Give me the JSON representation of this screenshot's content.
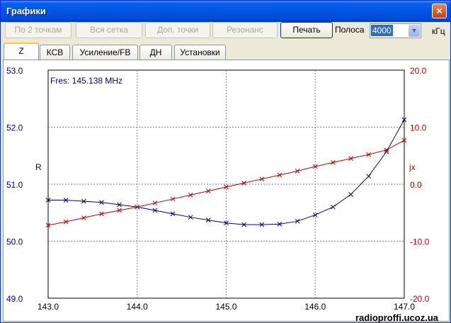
{
  "window": {
    "title": "Графики",
    "close_label": "×"
  },
  "toolbar": {
    "buttons": [
      "По 2 точкам",
      "Вся сетка",
      "Доп. точки",
      "Резонанс"
    ],
    "print_label": "Печать",
    "band_label": "Полоса",
    "band_value": "4000",
    "unit_label": "кГц"
  },
  "tabs": [
    "Z",
    "КСВ",
    "Усиление/FB",
    "ДН",
    "Установки"
  ],
  "active_tab": "Z",
  "chart": {
    "fres_text": "Fres: 145.138 MHz",
    "left_axis_label": "R",
    "right_axis_label": "jx",
    "watermark": "radioproffi.ucoz.ua"
  },
  "colors": {
    "r_series": "#00008b",
    "x_series": "#c00000",
    "grid": "#808080"
  },
  "chart_data": {
    "type": "line",
    "x_ticks": [
      "143.0",
      "144.0",
      "145.0",
      "146.0",
      "147.0"
    ],
    "xlim": [
      143.0,
      147.0
    ],
    "y_left_ticks": [
      "53.0",
      "52.0",
      "51.0",
      "50.0",
      "49.0"
    ],
    "ylim_left": [
      49.0,
      53.0
    ],
    "y_right_ticks": [
      "20.0",
      "10.0",
      "0.0",
      "-10.0",
      "-20.0"
    ],
    "ylim_right": [
      -20.0,
      20.0
    ],
    "grid": true,
    "series": [
      {
        "axis": "left",
        "color": "#00008b",
        "x": [
          143.0,
          143.2,
          143.4,
          143.6,
          143.8,
          144.0,
          144.2,
          144.4,
          144.6,
          144.8,
          145.0,
          145.2,
          145.4,
          145.6,
          145.8,
          146.0,
          146.2,
          146.4,
          146.6,
          146.8,
          147.0
        ],
        "values": [
          50.72,
          50.72,
          50.7,
          50.68,
          50.64,
          50.6,
          50.54,
          50.48,
          50.42,
          50.37,
          50.32,
          50.29,
          50.29,
          50.3,
          50.35,
          50.46,
          50.6,
          50.82,
          51.14,
          51.57,
          52.13
        ]
      },
      {
        "axis": "right",
        "color": "#c00000",
        "x": [
          143.0,
          143.2,
          143.4,
          143.6,
          143.8,
          144.0,
          144.2,
          144.4,
          144.6,
          144.8,
          145.0,
          145.2,
          145.4,
          145.6,
          145.8,
          146.0,
          146.2,
          146.4,
          146.6,
          146.8,
          147.0
        ],
        "values": [
          -7.2,
          -6.6,
          -5.9,
          -5.2,
          -4.6,
          -4.0,
          -3.3,
          -2.6,
          -1.9,
          -1.2,
          -0.5,
          0.2,
          0.9,
          1.6,
          2.3,
          3.1,
          3.8,
          4.5,
          5.2,
          6.0,
          7.7
        ]
      }
    ]
  }
}
